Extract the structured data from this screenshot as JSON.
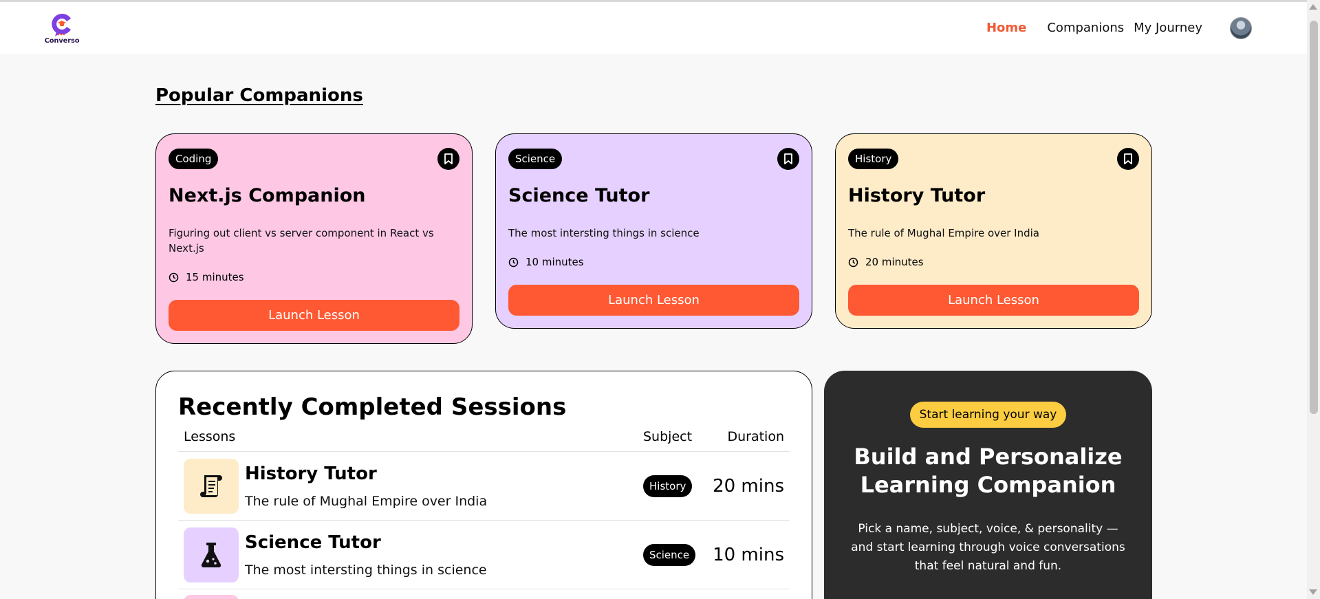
{
  "brand": {
    "name": "Converso",
    "accent": "#7b3fe4"
  },
  "nav": {
    "links": [
      {
        "label": "Home",
        "active": true
      },
      {
        "label": "Companions",
        "active": false
      },
      {
        "label": "My Journey",
        "active": false
      }
    ],
    "active_color": "#f05a34"
  },
  "popular": {
    "title": "Popular Companions",
    "cards": [
      {
        "subject": "Coding",
        "name": "Next.js Companion",
        "topic": "Figuring out client vs server component in React vs Next.js",
        "duration": "15 minutes",
        "button": "Launch Lesson",
        "color": "#fec8e5"
      },
      {
        "subject": "Science",
        "name": "Science Tutor",
        "topic": "The most intersting things in science",
        "duration": "10 minutes",
        "button": "Launch Lesson",
        "color": "#e5d0ff"
      },
      {
        "subject": "History",
        "name": "History Tutor",
        "topic": "The rule of Mughal Empire over India",
        "duration": "20 minutes",
        "button": "Launch Lesson",
        "color": "#feebc8"
      }
    ]
  },
  "recent": {
    "title": "Recently Completed Sessions",
    "columns": [
      "Lessons",
      "Subject",
      "Duration"
    ],
    "rows": [
      {
        "name": "History Tutor",
        "topic": "The rule of Mughal Empire over India",
        "subject": "History",
        "duration": "20 mins",
        "icon": "scroll-icon",
        "color": "#feebc8"
      },
      {
        "name": "Science Tutor",
        "topic": "The most intersting things in science",
        "subject": "Science",
        "duration": "10 mins",
        "icon": "flask-icon",
        "color": "#e5d0ff"
      }
    ]
  },
  "cta": {
    "badge": "Start learning your way",
    "title": "Build and Personalize Learning Companion",
    "description": "Pick a name, subject, voice, & personality — and start learning through voice conversations that feel natural and fun."
  },
  "colors": {
    "primary_button": "#fe5933",
    "cta_bg": "#2c2c2c",
    "badge_yellow": "#fccc41"
  }
}
